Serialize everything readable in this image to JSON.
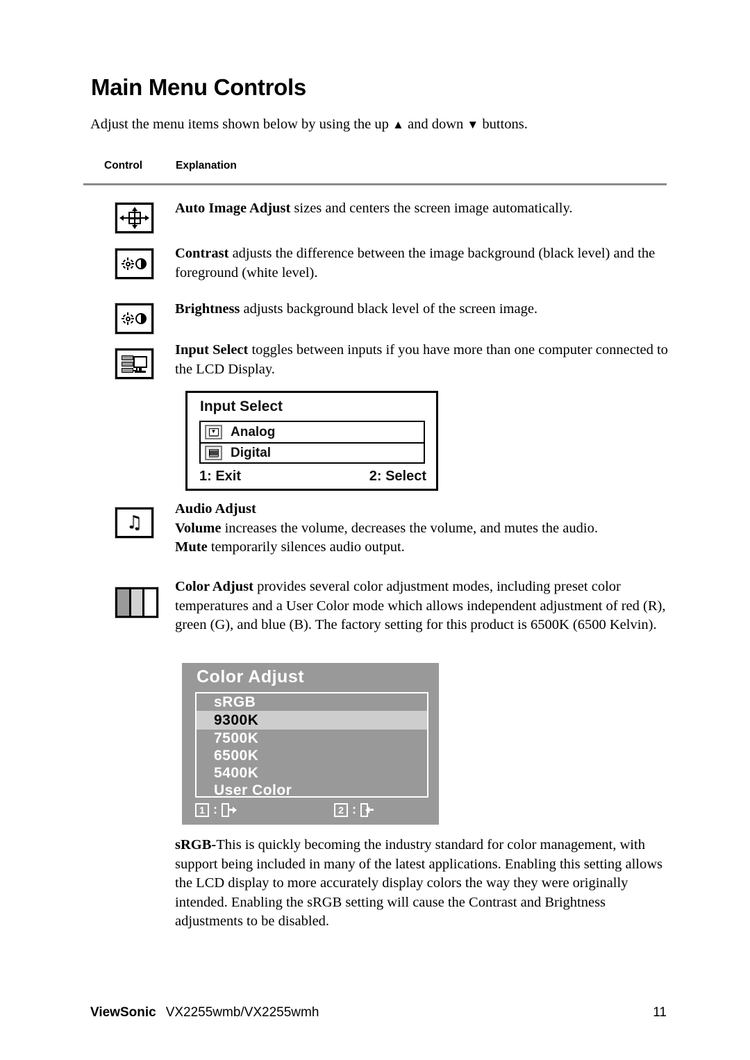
{
  "document": {
    "title": "Main Menu Controls",
    "intro_prefix": "Adjust the menu items shown below by using the up ",
    "intro_up_symbol": "▲",
    "intro_middle": " and down ",
    "intro_down_symbol": "▼",
    "intro_suffix": " buttons."
  },
  "table_headers": {
    "control": "Control",
    "explanation": "Explanation"
  },
  "controls": [
    {
      "icon": "auto-image-adjust-icon",
      "term": "Auto Image Adjust",
      "text": " sizes and centers the screen image automatically."
    },
    {
      "icon": "contrast-icon",
      "term": "Contrast",
      "text": " adjusts the difference between the image background  (black level) and the foreground (white level)."
    },
    {
      "icon": "brightness-icon",
      "term": "Brightness",
      "text": " adjusts background black level of the screen image."
    },
    {
      "icon": "input-select-icon",
      "term": "Input Select",
      "text": " toggles between inputs if you have more than one computer connected to the LCD Display."
    },
    {
      "icon": "audio-adjust-icon",
      "term": "Audio Adjust",
      "line2_term": "Volume",
      "line2_text": " increases the volume, decreases the volume, and mutes the audio.",
      "line3_term": "Mute",
      "line3_text": " temporarily silences audio output."
    },
    {
      "icon": "color-adjust-icon",
      "term": "Color Adjust",
      "text": " provides several color adjustment modes, including preset color temperatures and a User Color mode which allows independent adjustment of red (R), green (G), and blue (B). The factory setting for this product is 6500K (6500 Kelvin)."
    }
  ],
  "input_select_osd": {
    "title": "Input Select",
    "options": [
      {
        "label": "Analog",
        "icon": "monitor-analog-icon"
      },
      {
        "label": "Digital",
        "icon": "monitor-digital-icon"
      }
    ],
    "footer_left": "1: Exit",
    "footer_right": "2: Select"
  },
  "color_adjust_osd": {
    "title": "Color Adjust",
    "options": [
      {
        "label": "sRGB",
        "selected": false
      },
      {
        "label": "9300K",
        "selected": true
      },
      {
        "label": "7500K",
        "selected": false
      },
      {
        "label": "6500K",
        "selected": false
      },
      {
        "label": "5400K",
        "selected": false
      },
      {
        "label": "User Color",
        "selected": false
      }
    ],
    "footer": {
      "key1": "1",
      "key1_separator": ":",
      "key1_icon": "exit-door-arrow-out-icon",
      "key2": "2",
      "key2_separator": ":",
      "key2_icon": "enter-door-arrow-in-icon"
    },
    "background_color": "#999999",
    "highlight_color": "#cdcdcd",
    "text_color": "#ffffff",
    "highlight_text_color": "#000000"
  },
  "srgb_paragraph": {
    "term": "sRGB-",
    "text": "This is quickly becoming the industry standard for color management, with support being included in many of the latest applications. Enabling this setting allows the LCD display to more accurately display colors the way they were originally intended. Enabling the sRGB setting will cause the Contrast and Brightness adjustments to be disabled."
  },
  "footer": {
    "brand": "ViewSonic",
    "model": "VX2255wmb/VX2255wmh",
    "page_number": "11"
  }
}
